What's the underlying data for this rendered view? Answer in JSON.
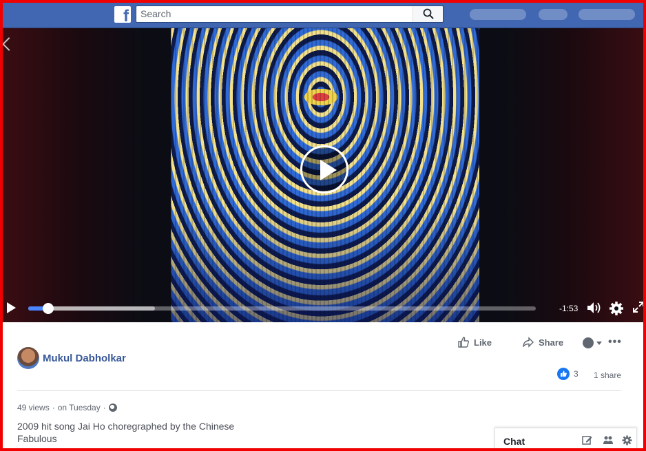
{
  "topbar": {
    "logo_letter": "f",
    "search_placeholder": "Search"
  },
  "video": {
    "time_remaining": "-1:53",
    "progress": 0.04,
    "buffered": 0.25
  },
  "post": {
    "author": "Mukul Dabholkar",
    "like_label": "Like",
    "share_label": "Share",
    "more_label": "•••",
    "reaction_count": "3",
    "share_count": "1 share",
    "views": "49 views",
    "separator": "·",
    "date": "on Tuesday",
    "caption_line1": "2009 hit song Jai Ho choregraphed by the Chinese",
    "caption_line2": "Fabulous"
  },
  "chat": {
    "label": "Chat"
  },
  "colors": {
    "brand": "#4267b2",
    "progress": "#4a86ff",
    "link": "#385898",
    "border": "#f00000"
  },
  "icons": [
    "facebook-logo-icon",
    "search-icon",
    "back-chevron-icon",
    "play-icon",
    "volume-icon",
    "settings-icon",
    "fullscreen-icon",
    "like-icon",
    "share-icon",
    "privacy-icon",
    "globe-icon",
    "compose-icon",
    "contacts-icon",
    "gear-icon"
  ]
}
